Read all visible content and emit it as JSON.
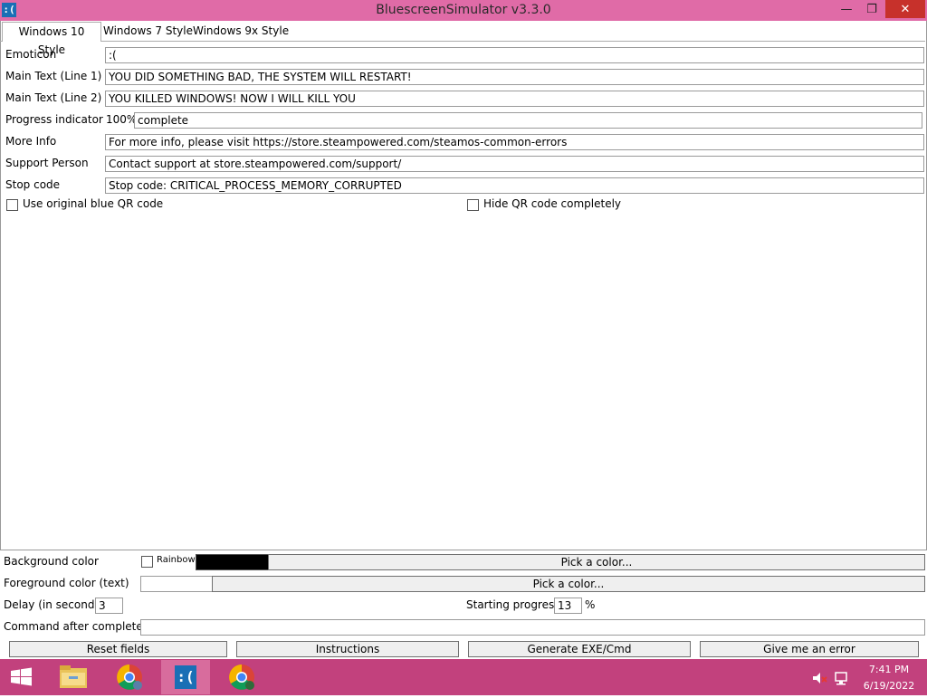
{
  "window": {
    "title": "BluescreenSimulator v3.3.0",
    "icon_text": ":(",
    "minimize_glyph": "—",
    "maximize_glyph": "❐",
    "close_glyph": "✕"
  },
  "tabs": [
    {
      "label": "Windows 10 Style",
      "active": true
    },
    {
      "label": "Windows 7 Style",
      "active": false
    },
    {
      "label": "Windows 9x Style",
      "active": false
    }
  ],
  "fields": {
    "emoticon": {
      "label": "Emoticon",
      "value": ":("
    },
    "main_text_1": {
      "label": "Main Text (Line 1)",
      "value": "YOU DID SOMETHING BAD, THE SYSTEM WILL RESTART!"
    },
    "main_text_2": {
      "label": "Main Text (Line 2)",
      "value": "YOU KILLED WINDOWS! NOW I WILL KILL YOU"
    },
    "progress": {
      "label": "Progress indicator",
      "prefix": "100%",
      "value": "complete"
    },
    "more_info": {
      "label": "More Info",
      "value": "For more info, please visit https://store.steampowered.com/steamos-common-errors"
    },
    "support_person": {
      "label": "Support Person",
      "value": "Contact support at store.steampowered.com/support/"
    },
    "stop_code": {
      "label": "Stop code",
      "value": "Stop code: CRITICAL_PROCESS_MEMORY_CORRUPTED"
    }
  },
  "checkboxes": {
    "original_qr": {
      "label": "Use original blue QR code",
      "checked": false
    },
    "hide_qr": {
      "label": "Hide QR code completely",
      "checked": false
    }
  },
  "bottom": {
    "background_color_label": "Background color",
    "rainbow_label": "Rainbow",
    "bg_swatch_color": "#000000",
    "pick_color_bg": "Pick a color...",
    "foreground_color_label": "Foreground color (text)",
    "fg_swatch_color": "#ffffff",
    "pick_color_fg": "Pick a color...",
    "delay_label": "Delay (in seconds)",
    "delay_value": "3",
    "starting_progress_label": "Starting progress",
    "starting_progress_value": "13",
    "percent_sign": "%",
    "command_label": "Command after complete",
    "command_value": ""
  },
  "buttons": {
    "reset": "Reset fields",
    "instructions": "Instructions",
    "generate": "Generate EXE/Cmd",
    "give_error": "Give me an error"
  },
  "taskbar": {
    "time": "7:41 PM",
    "date": "6/19/2022",
    "bluescreen_icon_text": ":(",
    "colors": {
      "taskbar": "#c2417d",
      "titlebar": "#e06ba7",
      "close": "#c7312b"
    }
  }
}
